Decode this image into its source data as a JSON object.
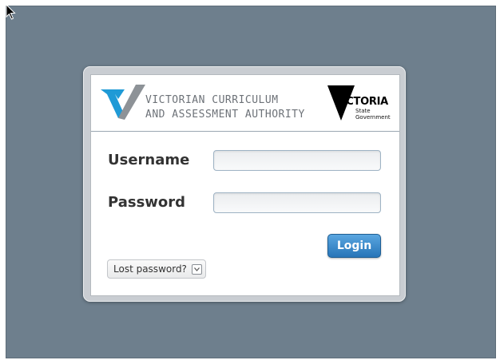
{
  "branding": {
    "vcaa_line1": "VICTORIAN CURRICULUM",
    "vcaa_line2": "AND ASSESSMENT AUTHORITY",
    "vic_word": "VICTORIA",
    "vic_sub_line1": "State",
    "vic_sub_line2": "Government",
    "colors": {
      "vcaa_blue": "#1f9ad6",
      "vcaa_grey": "#8d9297",
      "vic_black": "#000000"
    }
  },
  "form": {
    "username_label": "Username",
    "username_value": "",
    "password_label": "Password",
    "password_value": "",
    "login_label": "Login",
    "lost_password_label": "Lost password?"
  },
  "icons": {
    "cursor": "arrow-cursor-icon",
    "dropdown": "chevron-down-icon"
  },
  "colors": {
    "background": "#6e7f8d",
    "login_button": "#2f7fc2"
  }
}
